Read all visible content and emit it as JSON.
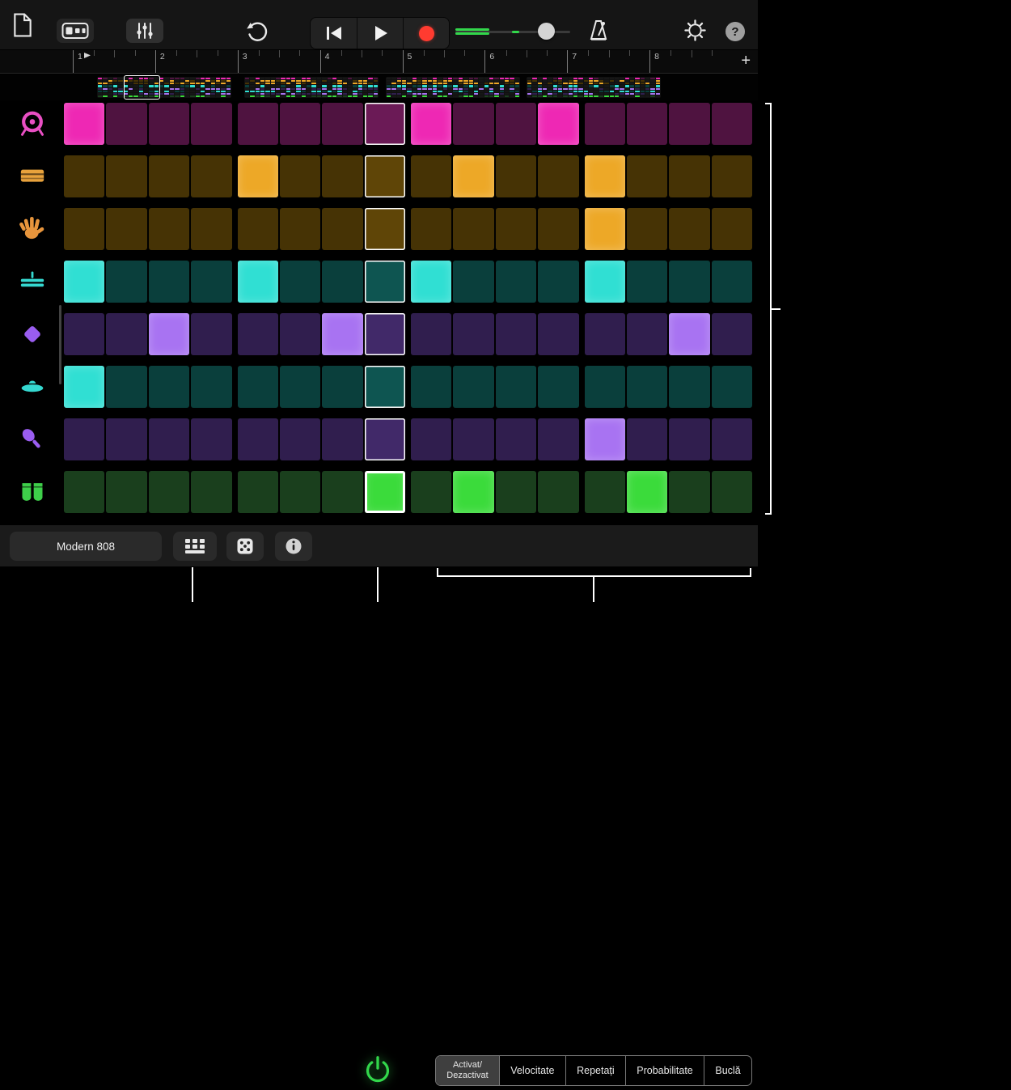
{
  "toolbar": {
    "items": [
      {
        "name": "new-document"
      },
      {
        "name": "track-view-toggle"
      },
      {
        "name": "mixer-controls"
      },
      {
        "name": "undo"
      },
      {
        "name": "skip-to-start"
      },
      {
        "name": "play"
      },
      {
        "name": "record"
      },
      {
        "name": "volume-slider"
      },
      {
        "name": "metronome"
      },
      {
        "name": "settings"
      },
      {
        "name": "help",
        "label": "?"
      }
    ]
  },
  "ruler": {
    "beats": [
      "1",
      "2",
      "3",
      "4",
      "5",
      "6",
      "7",
      "8"
    ],
    "add_label": "+"
  },
  "thumbnails": {
    "sections": [
      {
        "selected": true
      },
      {
        "selected": false
      },
      {
        "selected": false
      },
      {
        "selected": false
      }
    ]
  },
  "grid": {
    "columns": 16,
    "group_size": 4,
    "playhead_column": 8,
    "rows": [
      {
        "instrument": "kick-drum",
        "dim": "#4f1340",
        "bright": "#ee28b4",
        "icon_color": "#e94fc3",
        "steps": [
          1,
          9,
          12
        ]
      },
      {
        "instrument": "snare-drum",
        "dim": "#463305",
        "bright": "#eda827",
        "icon_color": "#e8a23c",
        "steps": [
          5,
          10,
          13
        ]
      },
      {
        "instrument": "clap",
        "dim": "#463305",
        "bright": "#eda827",
        "icon_color": "#e8953c",
        "steps": [
          13
        ]
      },
      {
        "instrument": "closed-hi-hat",
        "dim": "#0a3f3c",
        "bright": "#30dfd3",
        "icon_color": "#35d8d0",
        "steps": [
          1,
          5,
          9,
          13
        ]
      },
      {
        "instrument": "block",
        "dim": "#301e4e",
        "bright": "#a873f2",
        "icon_color": "#9a5df0",
        "steps": [
          3,
          7,
          15
        ]
      },
      {
        "instrument": "open-hi-hat",
        "dim": "#0a3f3c",
        "bright": "#30dfd3",
        "icon_color": "#35d8d0",
        "steps": [
          1
        ]
      },
      {
        "instrument": "shaker",
        "dim": "#301e4e",
        "bright": "#a873f2",
        "icon_color": "#9a5df0",
        "steps": [
          13
        ]
      },
      {
        "instrument": "congas",
        "dim": "#1a3f1d",
        "bright": "#3bdb3b",
        "icon_color": "#3ecf4a",
        "steps": [
          8,
          10,
          14
        ]
      }
    ]
  },
  "bottom_bar": {
    "patch_name": "Modern 808",
    "power_color": "#32d74b",
    "segments": [
      {
        "label": "Activat/\nDezactivat",
        "selected": true
      },
      {
        "label": "Velocitate",
        "selected": false
      },
      {
        "label": "Repetați",
        "selected": false
      },
      {
        "label": "Probabilitate",
        "selected": false
      },
      {
        "label": "Buclă",
        "selected": false
      }
    ]
  },
  "colors": {
    "accent_green": "#32d74b",
    "record_red": "#ff3b30"
  }
}
